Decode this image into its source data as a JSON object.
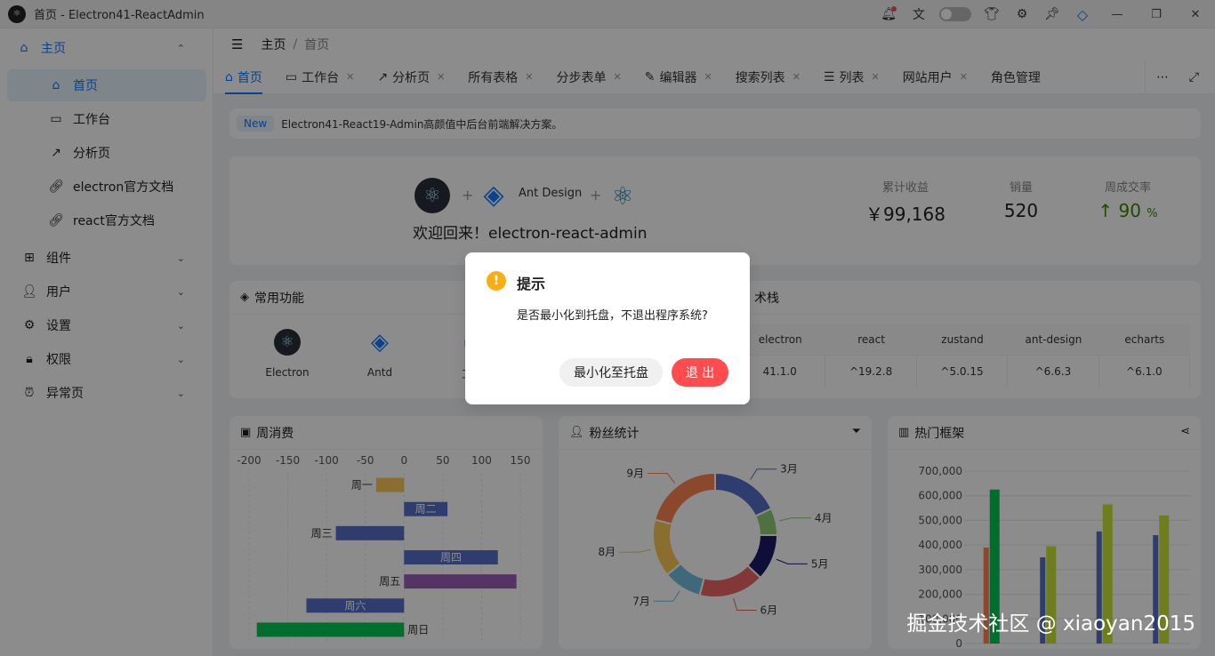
{
  "window": {
    "title": "首页 - Electron41-ReactAdmin"
  },
  "sidebar": {
    "items": [
      {
        "label": "主页",
        "icon": "home-icon"
      },
      {
        "label": "首页",
        "icon": "home-outline-icon"
      },
      {
        "label": "工作台",
        "icon": "desktop-icon"
      },
      {
        "label": "分析页",
        "icon": "line-chart-icon"
      },
      {
        "label": "electron官方文档",
        "icon": "link-icon"
      },
      {
        "label": "react官方文档",
        "icon": "link-icon"
      },
      {
        "label": "组件",
        "icon": "app-grid-icon"
      },
      {
        "label": "用户",
        "icon": "user-icon"
      },
      {
        "label": "设置",
        "icon": "gear-icon"
      },
      {
        "label": "权限",
        "icon": "lock-icon"
      },
      {
        "label": "异常页",
        "icon": "alarm-icon"
      }
    ]
  },
  "header": {
    "breadcrumb_root": "主页",
    "breadcrumb_sep": "/",
    "breadcrumb_current": "首页"
  },
  "tabs": [
    {
      "label": "首页"
    },
    {
      "label": "工作台"
    },
    {
      "label": "分析页"
    },
    {
      "label": "所有表格"
    },
    {
      "label": "分步表单"
    },
    {
      "label": "编辑器"
    },
    {
      "label": "搜索列表"
    },
    {
      "label": "列表"
    },
    {
      "label": "网站用户"
    },
    {
      "label": "角色管理"
    }
  ],
  "notice": {
    "badge": "New",
    "text": "Electron41-React19-Admin高颜值中后台前端解决方案。"
  },
  "welcome": {
    "antd_label": "Ant Design",
    "plus": "+",
    "text": "欢迎回来！electron-react-admin"
  },
  "stats": [
    {
      "label": "累计收益",
      "value": "￥99,168"
    },
    {
      "label": "销量",
      "value": "520"
    },
    {
      "label": "周成交率",
      "value": "90",
      "unit": "%"
    }
  ],
  "common": {
    "title": "常用功能",
    "items": [
      {
        "label": "Electron"
      },
      {
        "label": "Antd"
      },
      {
        "label": "工作"
      }
    ]
  },
  "tech": {
    "title_tail": "术栈",
    "headers": [
      "electron",
      "react",
      "zustand",
      "ant-design",
      "echarts"
    ],
    "versions": [
      "41.1.0",
      "^19.2.8",
      "^5.0.15",
      "^6.6.3",
      "^6.1.0"
    ]
  },
  "weekly": {
    "title": "周消费"
  },
  "fans": {
    "title": "粉丝统计"
  },
  "hot": {
    "title": "热门框架"
  },
  "modal": {
    "title": "提示",
    "content": "是否最小化到托盘，不退出程序系统?",
    "minimize_label": "最小化至托盘",
    "exit_label": "退 出"
  },
  "watermark": "掘金技术社区 @ xiaoyan2015",
  "chart_data": [
    {
      "type": "bar",
      "orientation": "horizontal",
      "categories": [
        "周一",
        "周二",
        "周三",
        "周四",
        "周五",
        "周六",
        "周日"
      ],
      "values": [
        -36,
        56,
        -88,
        121,
        145,
        -126,
        -190
      ],
      "colors": [
        "#fac858",
        "#5470c6",
        "#5470c6",
        "#5470c6",
        "#9a60b4",
        "#5470c6",
        "#00c853"
      ],
      "xticks": [
        "-200",
        "-150",
        "-100",
        "-50",
        "0",
        "50",
        "100",
        "150"
      ],
      "xlim": [
        -200,
        150
      ]
    },
    {
      "type": "pie",
      "donut": true,
      "categories": [
        "3月",
        "4月",
        "5月",
        "6月",
        "7月",
        "8月",
        "9月"
      ],
      "values": [
        18,
        7,
        12,
        17,
        10,
        15,
        21
      ],
      "colors": [
        "#5470c6",
        "#91cc75",
        "#1a1a66",
        "#ee6666",
        "#73c0de",
        "#fac858",
        "#fc8452"
      ]
    },
    {
      "type": "bar",
      "series_colors": [
        "#fc8452",
        "#00c853",
        "#5470c6",
        "#c8e639"
      ],
      "groups": [
        [
          390000,
          625000
        ],
        [
          350000,
          395000
        ],
        [
          455000,
          565000
        ],
        [
          440000,
          520000
        ]
      ],
      "yticks": [
        "0",
        "100,000",
        "200,000",
        "300,000",
        "400,000",
        "500,000",
        "600,000",
        "700,000"
      ],
      "ylim": [
        0,
        700000
      ]
    }
  ]
}
